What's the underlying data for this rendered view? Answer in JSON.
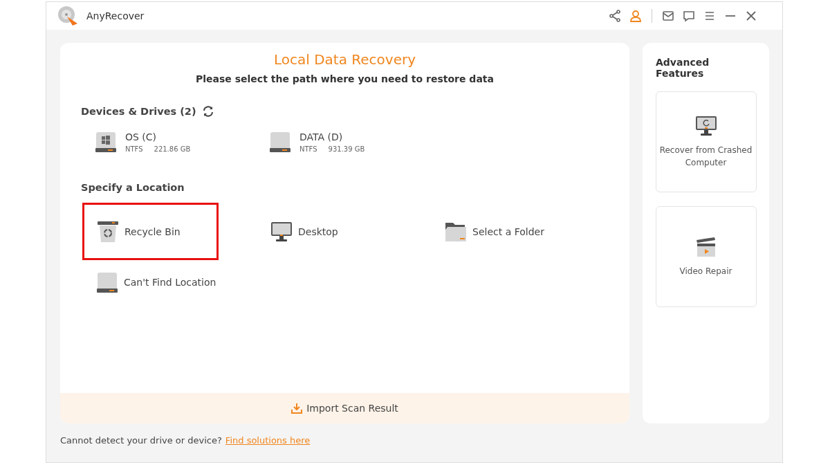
{
  "window": {
    "title": "AnyRecover"
  },
  "title_bar": {
    "icons": [
      {
        "kind": "share",
        "selected": false
      },
      {
        "kind": "user",
        "selected": true
      },
      {
        "kind": "mail",
        "selected": false
      },
      {
        "kind": "chat",
        "selected": false
      },
      {
        "kind": "menu",
        "selected": false
      },
      {
        "kind": "minimize",
        "selected": false
      },
      {
        "kind": "close",
        "selected": false
      }
    ]
  },
  "main": {
    "title": "Local Data Recovery",
    "subtitle": "Please select the path where you need to restore data",
    "devices_heading": "Devices & Drives (2)",
    "drives": [
      {
        "kind": "windows",
        "name": "OS (C)",
        "filesystem": "NTFS",
        "size": "221.86 GB"
      },
      {
        "kind": "plain",
        "name": "DATA (D)",
        "filesystem": "NTFS",
        "size": "931.39 GB"
      }
    ],
    "location_heading": "Specify a Location",
    "locations": [
      {
        "kind": "recycle",
        "label": "Recycle Bin",
        "highlighted": true
      },
      {
        "kind": "desktop",
        "label": "Desktop",
        "highlighted": false
      },
      {
        "kind": "folder",
        "label": "Select a Folder",
        "highlighted": false
      },
      {
        "kind": "drive",
        "label": "Can't Find Location",
        "highlighted": false
      }
    ],
    "import_button": "Import Scan Result"
  },
  "footer": {
    "text": "Cannot detect your drive or device?",
    "link": "Find solutions here"
  },
  "advanced": {
    "heading": "Advanced Features",
    "cards": [
      {
        "kind": "crashed",
        "label": "Recover from Crashed Computer"
      },
      {
        "kind": "video",
        "label": "Video Repair"
      }
    ]
  }
}
